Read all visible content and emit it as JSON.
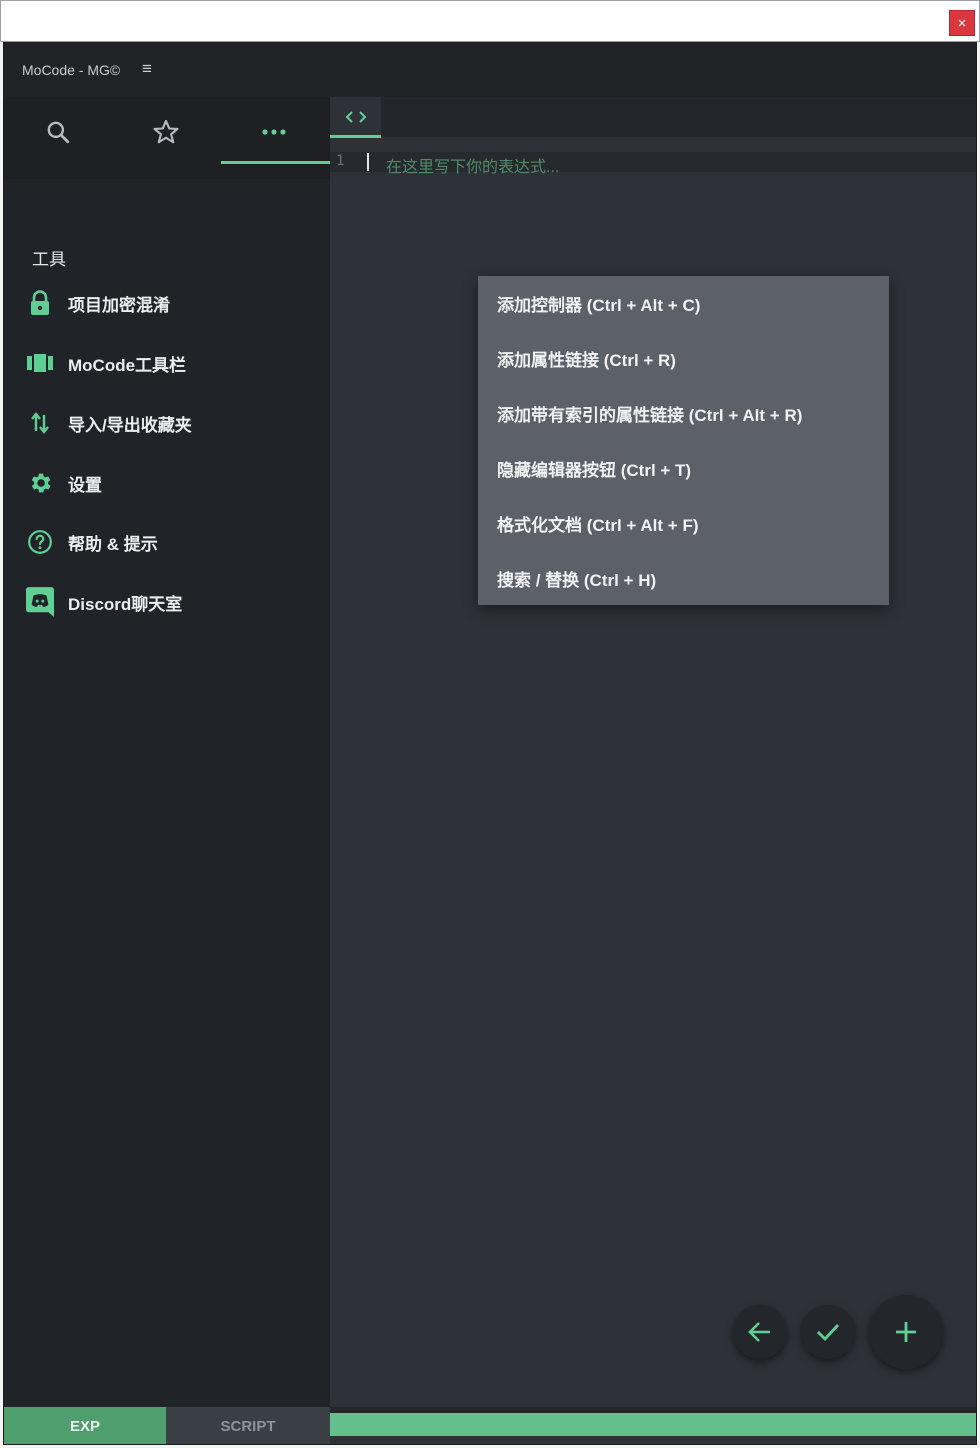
{
  "window": {
    "close_glyph": "×"
  },
  "topbar": {
    "title": "MoCode - MG©",
    "menu_icon": "hamburger-icon"
  },
  "sidebar": {
    "tabs": [
      {
        "icon": "search-icon"
      },
      {
        "icon": "star-icon"
      },
      {
        "icon": "more-horizontal-icon",
        "active": true
      }
    ],
    "heading": "工具",
    "items": [
      {
        "label": "项目加密混淆",
        "icon": "lock-icon"
      },
      {
        "label": "MoCode工具栏",
        "icon": "toolbar-icon"
      },
      {
        "label": "导入/导出收藏夹",
        "icon": "import-export-icon"
      },
      {
        "label": "设置",
        "icon": "gear-icon"
      },
      {
        "label": "帮助 & 提示",
        "icon": "help-icon"
      },
      {
        "label": "Discord聊天室",
        "icon": "discord-icon"
      }
    ],
    "bottom_tabs": {
      "exp": "EXP",
      "script": "SCRIPT",
      "active": "EXP"
    }
  },
  "editor": {
    "tab_icon": "code-brackets-icon",
    "line_number": "1",
    "placeholder": "在这里写下你的表达式..."
  },
  "context_menu": {
    "items": [
      "添加控制器 (Ctrl + Alt + C)",
      "添加属性链接 (Ctrl + R)",
      "添加带有索引的属性链接 (Ctrl + Alt + R)",
      "隐藏编辑器按钮 (Ctrl + T)",
      "格式化文档 (Ctrl + Alt + F)",
      "搜索 / 替换 (Ctrl + H)"
    ]
  },
  "fab_buttons": [
    {
      "icon": "arrow-left-icon"
    },
    {
      "icon": "check-icon"
    },
    {
      "icon": "plus-icon"
    }
  ],
  "colors": {
    "accent": "#5fcf94",
    "sidebar_bg": "#202328",
    "editor_bg": "#2e3238",
    "menu_bg": "#5c6068",
    "close": "#d9363e"
  }
}
